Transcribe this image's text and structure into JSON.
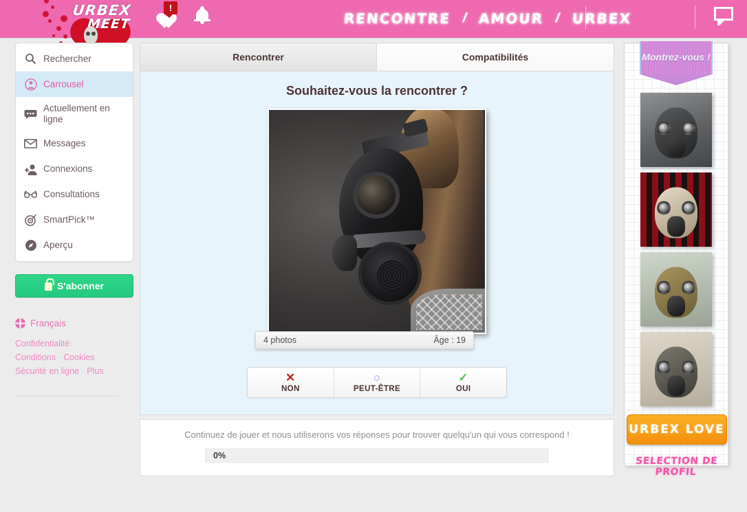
{
  "header": {
    "logo": {
      "line1": "URBEX",
      "line2": "MEET",
      "icon": "heart-skull-logo"
    },
    "alerts_icon": "heart-check-icon",
    "alerts_badge": "!",
    "bell_icon": "bell-icon",
    "chat_icon": "chat-bubble-icon",
    "nav": [
      {
        "label": "RENCONTRE"
      },
      {
        "label": "AMOUR"
      },
      {
        "label": "URBEX"
      }
    ],
    "nav_separator": "/",
    "brand_pink": "#ee69b0"
  },
  "sidebar": {
    "items": [
      {
        "label": "Rechercher",
        "icon": "search-icon",
        "active": false
      },
      {
        "label": "Carrousel",
        "icon": "carousel-icon",
        "active": true
      },
      {
        "label": "Actuellement en ligne",
        "icon": "online-icon",
        "active": false
      },
      {
        "label": "Messages",
        "icon": "envelope-icon",
        "active": false
      },
      {
        "label": "Connexions",
        "icon": "add-person-icon",
        "active": false
      },
      {
        "label": "Consultations",
        "icon": "glasses-icon",
        "active": false
      },
      {
        "label": "SmartPick™",
        "icon": "target-icon",
        "active": false
      },
      {
        "label": "Aperçu",
        "icon": "compass-icon",
        "active": false
      }
    ],
    "subscribe_label": "S'abonner",
    "subscribe_icon": "lock-icon",
    "subscribe_color": "#27cd82",
    "language": "Français",
    "language_icon": "globe-icon",
    "footer_links": [
      "Confidentialité",
      "Conditions",
      "Cookies",
      "Sécurité en ligne",
      "Plus"
    ],
    "footer_separator": "·"
  },
  "main": {
    "tabs": [
      {
        "label": "Rencontrer",
        "active": true
      },
      {
        "label": "Compatibilités",
        "active": false
      }
    ],
    "question": "Souhaitez-vous la rencontrer ?",
    "photo": {
      "alt": "profile-photo-gas-mask",
      "photo_count": "4 photos",
      "age": "Âge : 19"
    },
    "answers": [
      {
        "label": "NON",
        "glyph": "✕",
        "color": "#c0232b",
        "name": "no"
      },
      {
        "label": "PEUT-ÊTRE",
        "glyph": "○",
        "color": "#9b7fd4",
        "name": "maybe"
      },
      {
        "label": "OUI",
        "glyph": "✓",
        "color": "#55c35a",
        "name": "yes"
      }
    ],
    "progress": {
      "text": "Continuez de jouer et nous utiliserons vos réponses pour trouver quelqu'un qui vous correspond !",
      "percent_label": "0%",
      "percent_value": 0
    },
    "panel_bg": "#e8f4fb"
  },
  "right_sidebar": {
    "ribbon_label": "Montrez-vous !",
    "thumbnails": [
      {
        "alt": "gas-mask-thumb-1"
      },
      {
        "alt": "gas-mask-thumb-2"
      },
      {
        "alt": "gas-mask-thumb-3"
      },
      {
        "alt": "gas-mask-thumb-4"
      }
    ],
    "cta_label": "URBEX LOVE",
    "cta_color": "#f59a12",
    "section_label": "SELECTION DE PROFIL",
    "section_label_color": "#f255a8"
  }
}
